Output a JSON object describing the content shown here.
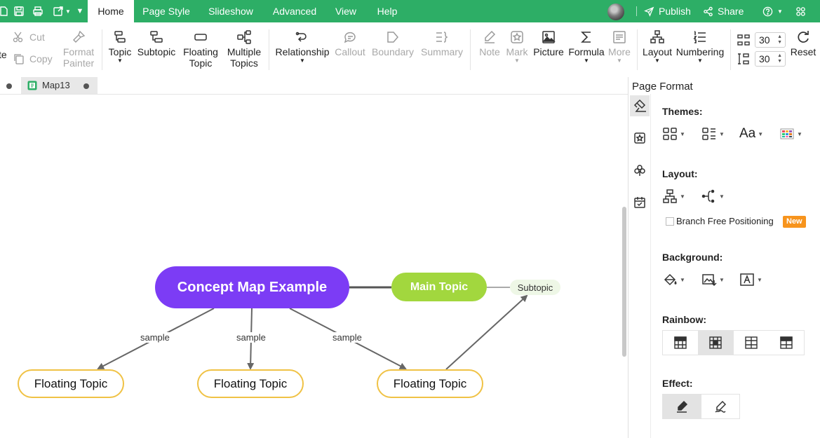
{
  "menubar": {
    "tabs": [
      "Home",
      "Page Style",
      "Slideshow",
      "Advanced",
      "View",
      "Help"
    ],
    "active_tab": "Home",
    "publish_label": "Publish",
    "share_label": "Share",
    "help_icon": "question-icon",
    "apps_icon": "apps-icon"
  },
  "ribbon": {
    "paste_partial": "te",
    "cut_label": "Cut",
    "copy_label": "Copy",
    "format_painter_label1": "Format",
    "format_painter_label2": "Painter",
    "topic_label": "Topic",
    "subtopic_label": "Subtopic",
    "floating_topic_label1": "Floating",
    "floating_topic_label2": "Topic",
    "multiple_topics_label1": "Multiple",
    "multiple_topics_label2": "Topics",
    "relationship_label": "Relationship",
    "callout_label": "Callout",
    "boundary_label": "Boundary",
    "summary_label": "Summary",
    "note_label": "Note",
    "mark_label": "Mark",
    "picture_label": "Picture",
    "formula_label": "Formula",
    "more_label": "More",
    "layout_label": "Layout",
    "numbering_label": "Numbering",
    "spacing_h_value": "30",
    "spacing_v_value": "30",
    "reset_label": "Reset"
  },
  "doc_tab": {
    "label": "Map13"
  },
  "canvas": {
    "central_topic": "Concept Map Example",
    "main_topic": "Main Topic",
    "subtopic": "Subtopic",
    "floating_topics": [
      "Floating Topic",
      "Floating Topic",
      "Floating Topic"
    ],
    "relationship_labels": [
      "sample",
      "sample",
      "sample"
    ],
    "colors": {
      "central": "#7c3cf5",
      "main": "#a2d73e",
      "floating_border": "#f0c245",
      "accent": "#2dae66"
    }
  },
  "panel": {
    "title": "Page Format",
    "themes_title": "Themes:",
    "layout_title": "Layout:",
    "branch_free_label": "Branch Free Positioning",
    "new_badge": "New",
    "background_title": "Background:",
    "rainbow_title": "Rainbow:",
    "effect_title": "Effect:"
  }
}
